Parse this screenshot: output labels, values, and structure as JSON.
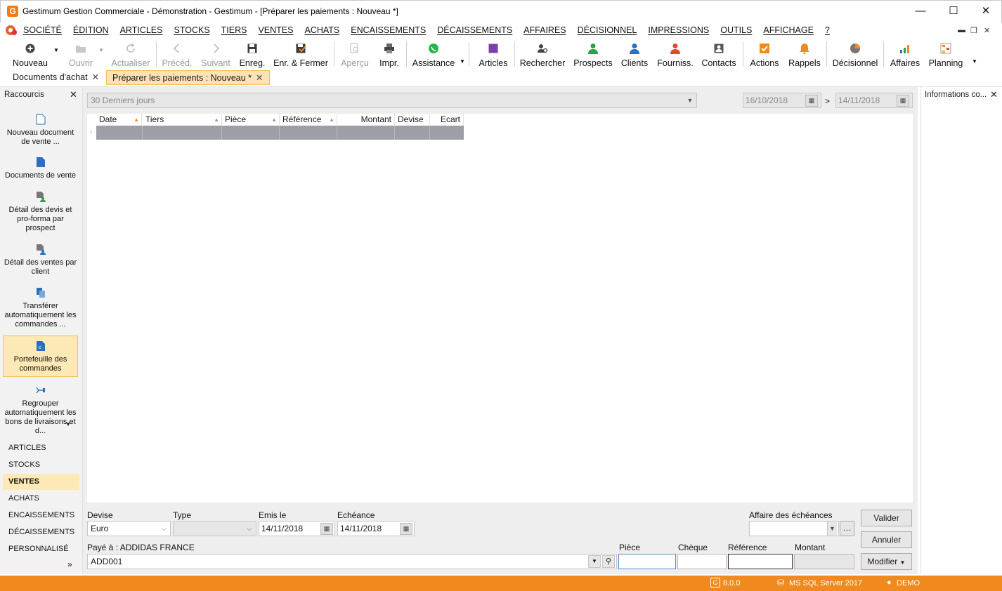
{
  "window": {
    "title": "Gestimum Gestion Commerciale - Démonstration - Gestimum - [Préparer les paiements : Nouveau *]",
    "app_icon": "G"
  },
  "menu": [
    "SOCIÉTÉ",
    "ÉDITION",
    "ARTICLES",
    "STOCKS",
    "TIERS",
    "VENTES",
    "ACHATS",
    "ENCAISSEMENTS",
    "DÉCAISSEMENTS",
    "AFFAIRES",
    "DÉCISIONNEL",
    "IMPRESSIONS",
    "OUTILS",
    "AFFICHAGE",
    "?"
  ],
  "toolbar": {
    "nouveau": "Nouveau",
    "ouvrir": "Ouvrir",
    "actualiser": "Actualiser",
    "preced": "Précéd.",
    "suivant": "Suivant",
    "enreg": "Enreg.",
    "enr_fermer": "Enr. & Fermer",
    "apercu": "Aperçu",
    "impr": "Impr.",
    "assistance": "Assistance",
    "articles": "Articles",
    "rechercher": "Rechercher",
    "prospects": "Prospects",
    "clients": "Clients",
    "fourniss": "Fourniss.",
    "contacts": "Contacts",
    "actions": "Actions",
    "rappels": "Rappels",
    "decisionnel": "Décisionnel",
    "affaires": "Affaires",
    "planning": "Planning"
  },
  "tabs": {
    "tab1": "Documents d'achat",
    "tab2": "Préparer les paiements : Nouveau *"
  },
  "sidebar": {
    "header": "Raccourcis",
    "shortcuts": [
      "Nouveau document de vente ...",
      "Documents de vente",
      "Détail des devis et pro-forma par prospect",
      "Détail des ventes par client",
      "Transférer automatiquement les commandes ...",
      "Portefeuille des commandes",
      "Regrouper automatiquement les bons de livraisons et d..."
    ],
    "nav": [
      "ARTICLES",
      "STOCKS",
      "VENTES",
      "ACHATS",
      "ENCAISSEMENTS",
      "DÉCAISSEMENTS",
      "PERSONNALISÉ"
    ],
    "more": "»"
  },
  "right_panel": {
    "title": "Informations co..."
  },
  "filter": {
    "period": "30 Derniers jours",
    "date_from": "16/10/2018",
    "sep": ">",
    "date_to": "14/11/2018"
  },
  "grid": {
    "columns": [
      "Date",
      "Tiers",
      "Pièce",
      "Référence",
      "Montant",
      "Devise",
      "Ecart"
    ]
  },
  "form": {
    "devise_label": "Devise",
    "devise_value": "Euro",
    "type_label": "Type",
    "type_value": "",
    "emis_label": "Emis le",
    "emis_value": "14/11/2018",
    "echeance_label": "Echéance",
    "echeance_value": "14/11/2018",
    "affaire_label": "Affaire des échéances",
    "affaire_value": "",
    "paye_label": "Payé à  : ADDIDAS FRANCE",
    "paye_value": "ADD001",
    "piece_label": "Pièce",
    "cheque_label": "Chèque",
    "reference_label": "Référence",
    "montant_label": "Montant",
    "valider": "Valider",
    "annuler": "Annuler",
    "modifier": "Modifier"
  },
  "status": {
    "version": "8.0.0",
    "db": "MS SQL Server 2017",
    "user": "DEMO"
  },
  "colors": {
    "accent": "#f08a1e",
    "selection": "#fde9b5",
    "row_selected": "#9e9ea8"
  }
}
